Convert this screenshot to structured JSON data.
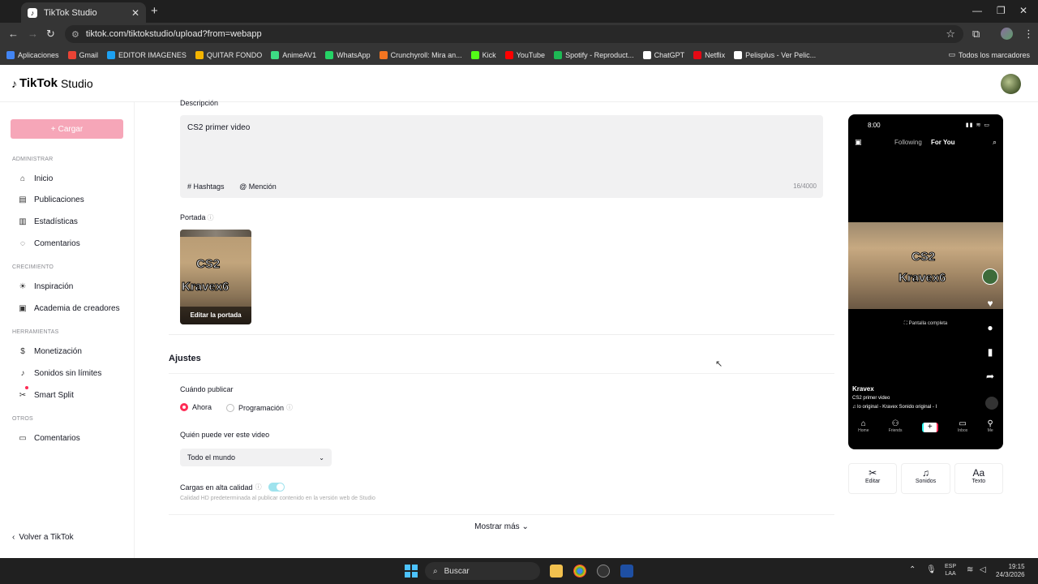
{
  "browser": {
    "tab_title": "TikTok Studio",
    "url": "tiktok.com/tiktokstudio/upload?from=webapp",
    "bookmarks": [
      {
        "label": "Aplicaciones",
        "color": "#4285f4"
      },
      {
        "label": "Gmail",
        "color": "#ea4335"
      },
      {
        "label": "EDITOR IMAGENES",
        "color": "#1da1f2"
      },
      {
        "label": "QUITAR FONDO",
        "color": "#f4b400"
      },
      {
        "label": "AnimeAV1",
        "color": "#3ddc84"
      },
      {
        "label": "WhatsApp",
        "color": "#25d366"
      },
      {
        "label": "Crunchyroll: Mira an...",
        "color": "#f47521"
      },
      {
        "label": "Kick",
        "color": "#53fc18"
      },
      {
        "label": "YouTube",
        "color": "#ff0000"
      },
      {
        "label": "Spotify - Reproduct...",
        "color": "#1db954"
      },
      {
        "label": "ChatGPT",
        "color": "#ffffff"
      },
      {
        "label": "Netflix",
        "color": "#e50914"
      },
      {
        "label": "Pelisplus - Ver Pelic...",
        "color": "#ffffff"
      }
    ],
    "all_bookmarks": "Todos los marcadores"
  },
  "header": {
    "brand": "TikTok",
    "product": "Studio"
  },
  "sidebar": {
    "upload_label": "Cargar",
    "sections": {
      "admin": "ADMINISTRAR",
      "growth": "CRECIMIENTO",
      "tools": "HERRAMIENTAS",
      "others": "OTROS"
    },
    "items": {
      "home": "Inicio",
      "posts": "Publicaciones",
      "stats": "Estadísticas",
      "comments": "Comentarios",
      "inspiration": "Inspiración",
      "academy": "Academia de creadores",
      "monetization": "Monetización",
      "sounds": "Sonidos sin límites",
      "smart_split": "Smart Split",
      "comments2": "Comentarios"
    },
    "back": "Volver a TikTok"
  },
  "upload": {
    "description_label": "Descripción",
    "description_value": "CS2 primer video",
    "hashtags": "Hashtags",
    "mention": "Mención",
    "char_count": "16/4000",
    "cover_label": "Portada",
    "cover_text_line1": "CS2",
    "cover_text_line2": "Kravex6",
    "edit_cover": "Editar la portada"
  },
  "settings": {
    "title": "Ajustes",
    "when_label": "Cuándo publicar",
    "now": "Ahora",
    "schedule": "Programación",
    "who_label": "Quién puede ver este video",
    "who_value": "Todo el mundo",
    "hq_label": "Cargas en alta calidad",
    "hq_enabled": true,
    "hq_sub": "Calidad HD predeterminada al publicar contenido en la versión web de Studio",
    "show_more": "Mostrar más"
  },
  "preview": {
    "time": "8:00",
    "following": "Following",
    "for_you": "For You",
    "fullscreen": "Pantalla completa",
    "username": "Kravex",
    "caption": "CS2 primer video",
    "music": "lo original - Kravex    Sonido original - I",
    "nav": [
      "Home",
      "Friends",
      "",
      "Inbox",
      "Me"
    ],
    "tools": [
      {
        "label": "Editar",
        "icon": "scissors-icon"
      },
      {
        "label": "Sonidos",
        "icon": "music-note-icon"
      },
      {
        "label": "Texto",
        "icon": "text-icon"
      }
    ]
  },
  "taskbar": {
    "search": "Buscar",
    "lang1": "ESP",
    "lang2": "LAA",
    "time": "19:15",
    "date": "24/3/2026"
  }
}
